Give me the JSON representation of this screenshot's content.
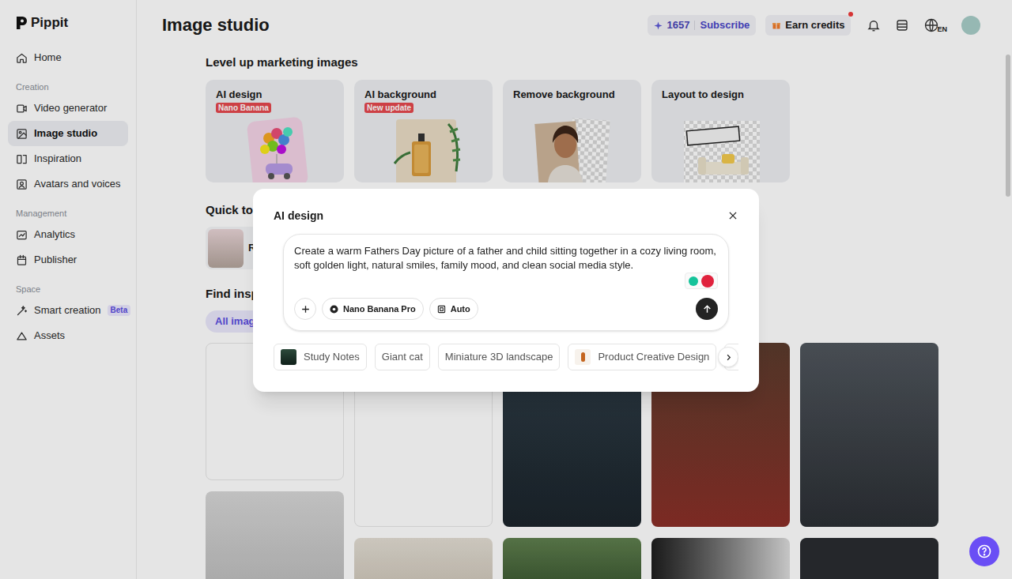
{
  "app": {
    "logo": "Pippit"
  },
  "sidebar": {
    "items": [
      {
        "kind": "link",
        "label": "Home",
        "selected": false
      },
      {
        "kind": "section",
        "label": "Creation"
      },
      {
        "kind": "link",
        "label": "Video generator",
        "selected": false
      },
      {
        "kind": "link",
        "label": "Image studio",
        "selected": true
      },
      {
        "kind": "link",
        "label": "Inspiration",
        "selected": false
      },
      {
        "kind": "link",
        "label": "Avatars and voices",
        "selected": false
      },
      {
        "kind": "section",
        "label": "Management"
      },
      {
        "kind": "link",
        "label": "Analytics",
        "selected": false
      },
      {
        "kind": "link",
        "label": "Publisher",
        "selected": false
      },
      {
        "kind": "section",
        "label": "Space"
      },
      {
        "kind": "link",
        "label": "Smart creation",
        "badge": "Beta",
        "selected": false
      },
      {
        "kind": "link",
        "label": "Assets",
        "selected": false
      }
    ]
  },
  "header": {
    "title": "Image studio",
    "credits": "1657",
    "subscribe": "Subscribe",
    "earn_credits": "Earn credits",
    "earn_credits_dot": true,
    "language": "EN"
  },
  "marketing": {
    "title": "Level up marketing images",
    "cards": [
      {
        "title": "AI design",
        "badge": "Nano Banana"
      },
      {
        "title": "AI background",
        "badge": "New update"
      },
      {
        "title": "Remove background"
      },
      {
        "title": "Layout to design"
      }
    ]
  },
  "quick_tools": {
    "title": "Quick too",
    "items": [
      {
        "label": "R"
      }
    ]
  },
  "inspiration": {
    "title": "Find inspi",
    "filters": [
      {
        "label": "All image",
        "selected": true
      }
    ]
  },
  "dialog": {
    "title": "AI design",
    "prompt": "Create a warm Fathers Day picture of a father and child sitting together in a cozy living room, soft golden light, natural smiles, family mood, and clean social media style.",
    "model": "Nano Banana Pro",
    "ratio": "Auto",
    "suggestions": [
      {
        "label": "Study Notes",
        "kind": "image"
      },
      {
        "label": "Giant cat",
        "kind": "text"
      },
      {
        "label": "Miniature 3D landscape",
        "kind": "text"
      },
      {
        "label": "Product Creative Design",
        "kind": "image"
      },
      {
        "label": "S",
        "kind": "text"
      }
    ]
  }
}
